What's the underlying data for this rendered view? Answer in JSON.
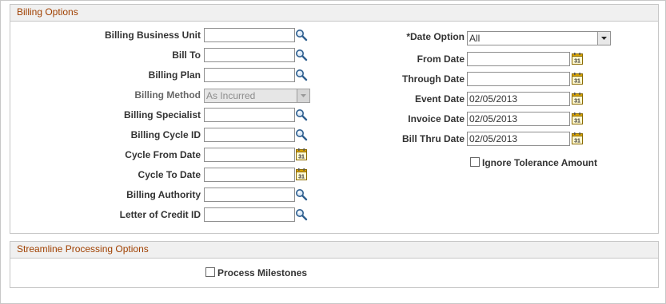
{
  "billing_options": {
    "title": "Billing Options",
    "left_fields": [
      {
        "label": "Billing Business Unit",
        "type": "lookup",
        "value": ""
      },
      {
        "label": "Bill To",
        "type": "lookup",
        "value": ""
      },
      {
        "label": "Billing Plan",
        "type": "lookup",
        "value": ""
      },
      {
        "label": "Billing Method",
        "type": "dropdown-disabled",
        "value": "As Incurred"
      },
      {
        "label": "Billing Specialist",
        "type": "lookup",
        "value": ""
      },
      {
        "label": "Billing Cycle ID",
        "type": "lookup",
        "value": ""
      },
      {
        "label": "Cycle From Date",
        "type": "date",
        "value": ""
      },
      {
        "label": "Cycle To Date",
        "type": "date",
        "value": ""
      },
      {
        "label": "Billing Authority",
        "type": "lookup",
        "value": ""
      },
      {
        "label": "Letter of Credit ID",
        "type": "lookup",
        "value": ""
      }
    ],
    "date_option": {
      "label": "*Date Option",
      "value": "All"
    },
    "right_fields": [
      {
        "label": "From Date",
        "value": ""
      },
      {
        "label": "Through Date",
        "value": ""
      },
      {
        "label": "Event Date",
        "value": "02/05/2013"
      },
      {
        "label": "Invoice Date",
        "value": "02/05/2013"
      },
      {
        "label": "Bill Thru Date",
        "value": "02/05/2013"
      }
    ],
    "ignore_tolerance": {
      "label": "Ignore Tolerance Amount",
      "checked": false
    }
  },
  "streamline": {
    "title": "Streamline Processing Options",
    "process_milestones": {
      "label": "Process Milestones",
      "checked": false
    }
  },
  "icons": {
    "lookup": "magnifier-icon",
    "calendar": "calendar-icon"
  },
  "colors": {
    "header_text": "#a04000",
    "header_bg": "#f0f0f0",
    "border": "#c6c6c6"
  }
}
